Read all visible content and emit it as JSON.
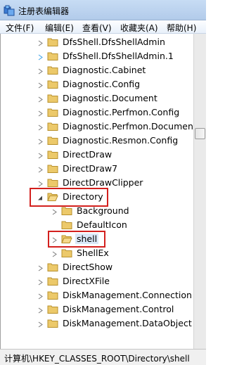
{
  "window": {
    "title": "注册表编辑器"
  },
  "menu": [
    {
      "label": "文件(F)"
    },
    {
      "label": "编辑(E)"
    },
    {
      "label": "查看(V)"
    },
    {
      "label": "收藏夹(A)"
    },
    {
      "label": "帮助(H)"
    }
  ],
  "tree": {
    "rows": [
      {
        "label": "DfsShell.DfsShellAdmin",
        "expander": "collapsed"
      },
      {
        "label": "DfsShell.DfsShellAdmin.1",
        "expander": "collapsed-blue"
      },
      {
        "label": "Diagnostic.Cabinet",
        "expander": "collapsed"
      },
      {
        "label": "Diagnostic.Config",
        "expander": "collapsed"
      },
      {
        "label": "Diagnostic.Document",
        "expander": "collapsed"
      },
      {
        "label": "Diagnostic.Perfmon.Config",
        "expander": "collapsed"
      },
      {
        "label": "Diagnostic.Perfmon.Document",
        "expander": "collapsed"
      },
      {
        "label": "Diagnostic.Resmon.Config",
        "expander": "collapsed"
      },
      {
        "label": "DirectDraw",
        "expander": "collapsed"
      },
      {
        "label": "DirectDraw7",
        "expander": "collapsed"
      },
      {
        "label": "DirectDrawClipper",
        "expander": "collapsed"
      },
      {
        "label": "Directory",
        "expander": "expanded"
      },
      {
        "label": "Background",
        "expander": "collapsed"
      },
      {
        "label": "DefaultIcon",
        "expander": "none"
      },
      {
        "label": "shell",
        "expander": "collapsed"
      },
      {
        "label": "ShellEx",
        "expander": "collapsed"
      },
      {
        "label": "DirectShow",
        "expander": "collapsed"
      },
      {
        "label": "DirectXFile",
        "expander": "collapsed"
      },
      {
        "label": "DiskManagement.Connection",
        "expander": "collapsed"
      },
      {
        "label": "DiskManagement.Control",
        "expander": "collapsed"
      },
      {
        "label": "DiskManagement.DataObject",
        "expander": "collapsed"
      }
    ]
  },
  "statusbar": {
    "path": "计算机\\HKEY_CLASSES_ROOT\\Directory\\shell"
  },
  "colors": {
    "highlight_box": "#d3201e",
    "folder": "#e9c46a",
    "selection": "#dbe8f8"
  }
}
